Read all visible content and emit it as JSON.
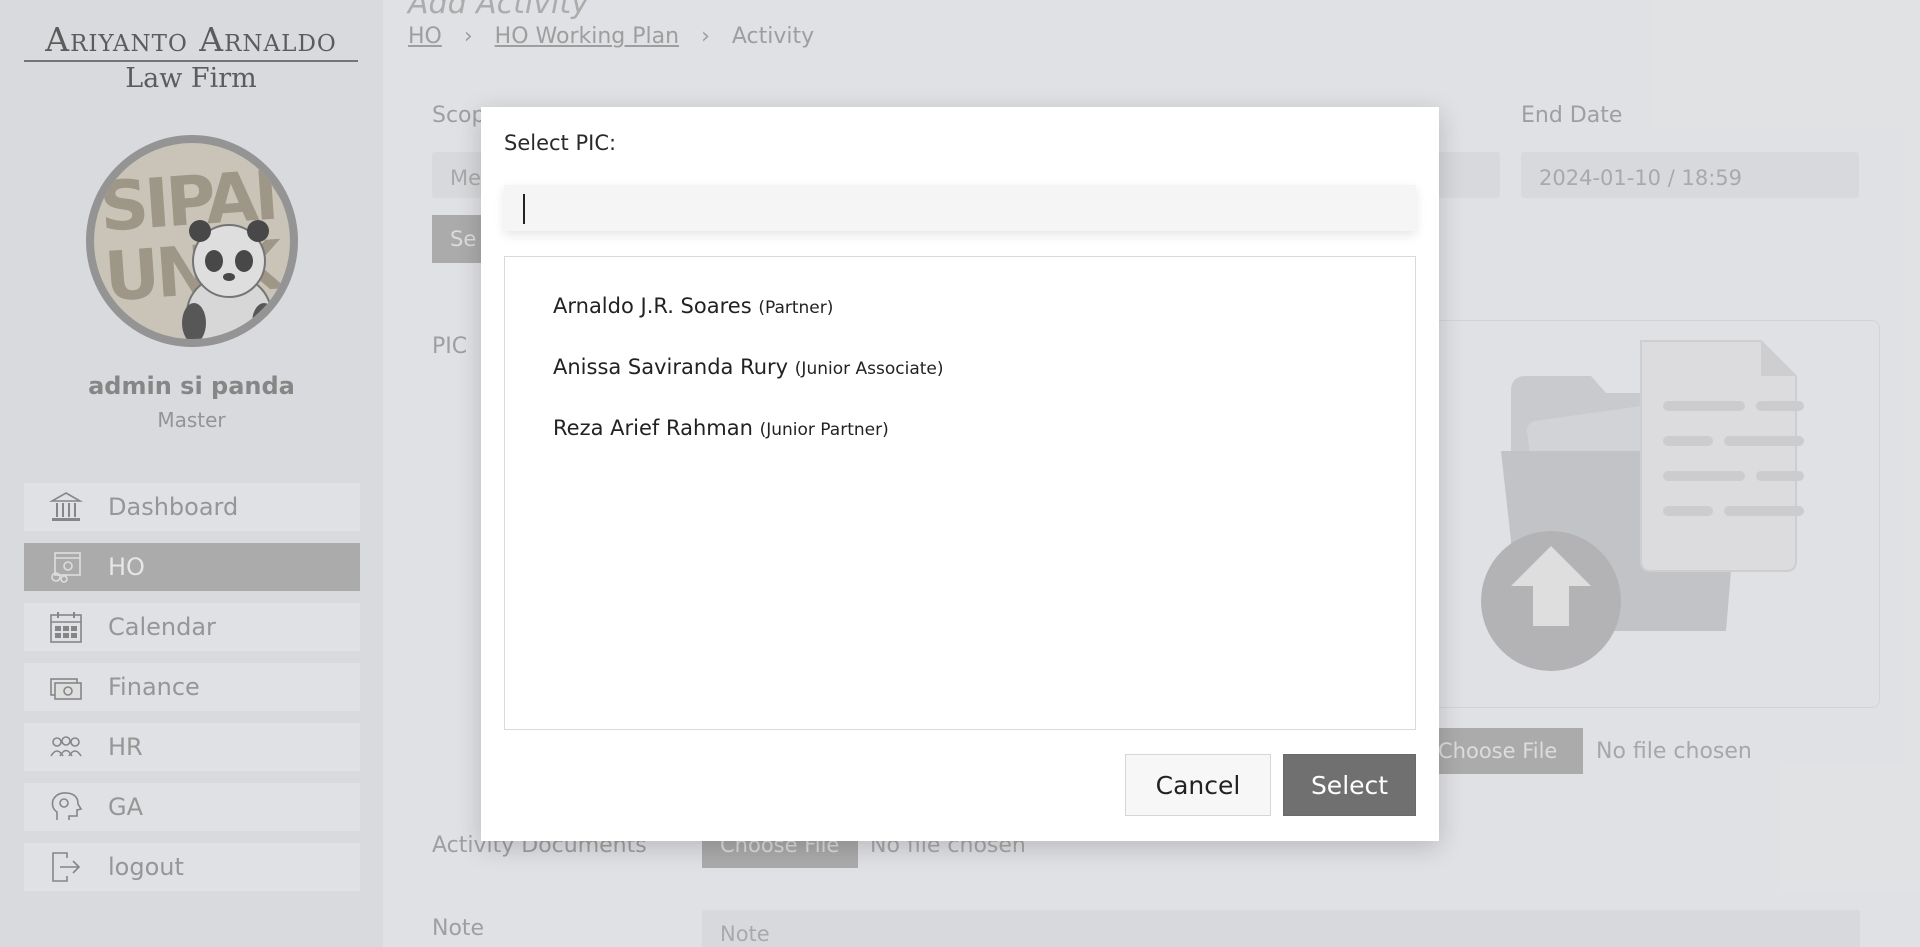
{
  "brand": {
    "line1": "Ariyanto Arnaldo",
    "line2": "Law Firm"
  },
  "avatar": {
    "text": "SIPANDA\nUNIK"
  },
  "user": {
    "name": "admin si panda",
    "role": "Master"
  },
  "nav": {
    "items": [
      {
        "label": "Dashboard",
        "icon": "bank-icon"
      },
      {
        "label": "HO",
        "icon": "office-gear-icon",
        "active": true
      },
      {
        "label": "Calendar",
        "icon": "calendar-icon"
      },
      {
        "label": "Finance",
        "icon": "money-icon"
      },
      {
        "label": "HR",
        "icon": "people-icon"
      },
      {
        "label": "GA",
        "icon": "head-gear-icon"
      },
      {
        "label": "logout",
        "icon": "logout-icon"
      }
    ]
  },
  "page": {
    "title": "Add Activity",
    "breadcrumb": [
      "HO",
      "HO Working Plan",
      "Activity"
    ]
  },
  "form": {
    "scope_label": "Scop",
    "scope_placeholder": "Me",
    "scope_button": "Se",
    "end_date_label": "End Date",
    "end_date_value": "2024-01-10 / 18:59",
    "pic_label": "PIC",
    "choose_file_label": "Choose File",
    "no_file_text": "No file chosen",
    "activity_documents_label": "Activity Documents",
    "activity_choose_file_label": "Choose File",
    "activity_no_file_text": "No file chosen",
    "note_label": "Note",
    "note_placeholder": "Note"
  },
  "modal": {
    "title": "Select PIC:",
    "search_value": "",
    "options": [
      {
        "name": "Arnaldo J.R. Soares",
        "role": "(Partner)"
      },
      {
        "name": "Anissa Saviranda Rury",
        "role": "(Junior Associate)"
      },
      {
        "name": "Reza Arief Rahman",
        "role": "(Junior Partner)"
      }
    ],
    "cancel_label": "Cancel",
    "select_label": "Select"
  },
  "colors": {
    "sidebar_bg": "#e9eaec",
    "active_nav": "#b4b4b4",
    "select_button": "#707070",
    "modal_bg": "#ffffff"
  }
}
